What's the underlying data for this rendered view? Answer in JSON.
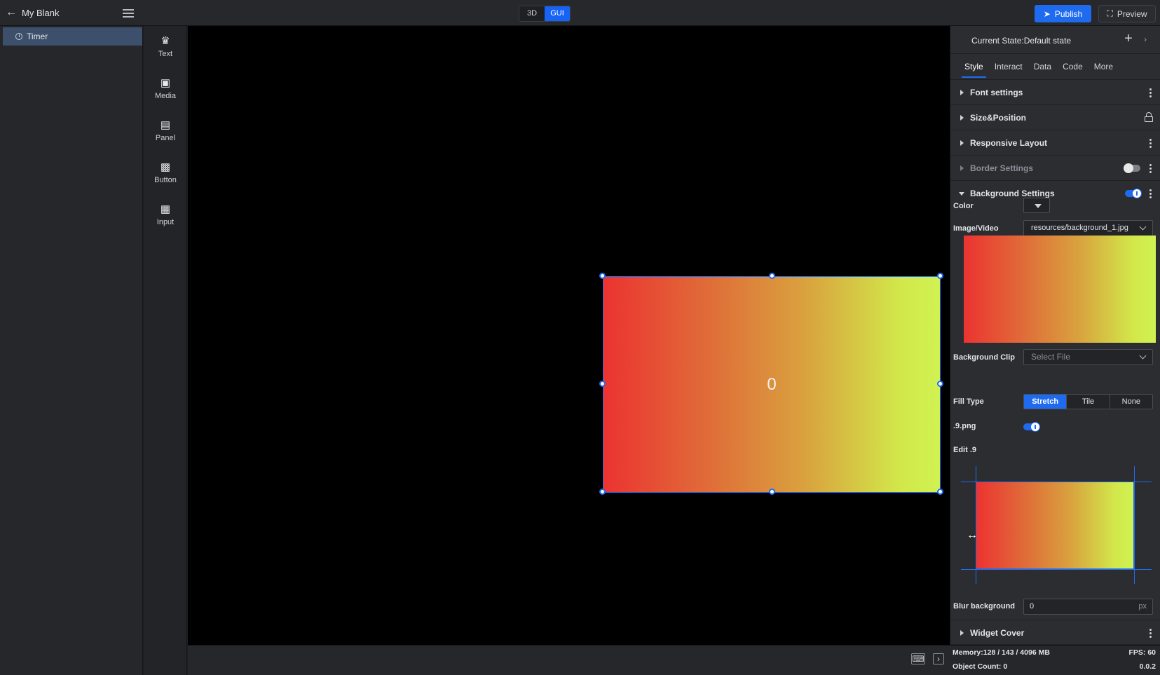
{
  "header": {
    "app_title": "My Blank",
    "mode_3d": "3D",
    "mode_gui": "GUI",
    "active_mode": "GUI",
    "publish_label": "Publish",
    "preview_label": "Preview",
    "accent_color": "#1f6bf0"
  },
  "tree": {
    "items": [
      {
        "label": "Timer",
        "icon": "clock-icon",
        "selected": true
      }
    ]
  },
  "widgets": [
    {
      "label": "Text",
      "icon": "text-icon"
    },
    {
      "label": "Media",
      "icon": "media-icon"
    },
    {
      "label": "Panel",
      "icon": "panel-icon"
    },
    {
      "label": "Button",
      "icon": "button-icon"
    },
    {
      "label": "Input",
      "icon": "input-icon"
    }
  ],
  "canvas": {
    "widget_value": "0"
  },
  "panel": {
    "current_state": "Current State:Default state",
    "tabs": [
      "Style",
      "Interact",
      "Data",
      "Code",
      "More"
    ],
    "active_tab": "Style",
    "sections": {
      "font": "Font settings",
      "size": "Size&Position",
      "responsive": "Responsive Layout",
      "border": "Border Settings",
      "background": "Background Settings",
      "cover": "Widget Cover"
    },
    "border_enabled": false,
    "background_enabled": true,
    "background": {
      "color_label": "Color",
      "image_label": "Image/Video",
      "image_value": "resources/background_1.jpg",
      "clip_label": "Background Clip",
      "clip_placeholder": "Select File",
      "fill_label": "Fill Type",
      "fill_options": [
        "Stretch",
        "Tile",
        "None"
      ],
      "fill_selected": "Stretch",
      "ninepatch_label": ".9.png",
      "ninepatch_enabled": true,
      "edit9_label": "Edit .9",
      "blur_label": "Blur background",
      "blur_value": "0",
      "blur_unit": "px"
    }
  },
  "status": {
    "memory": "Memory:128 / 143 / 4096 MB",
    "fps": "FPS: 60",
    "objects": "Object Count: 0",
    "version": "0.0.2"
  }
}
